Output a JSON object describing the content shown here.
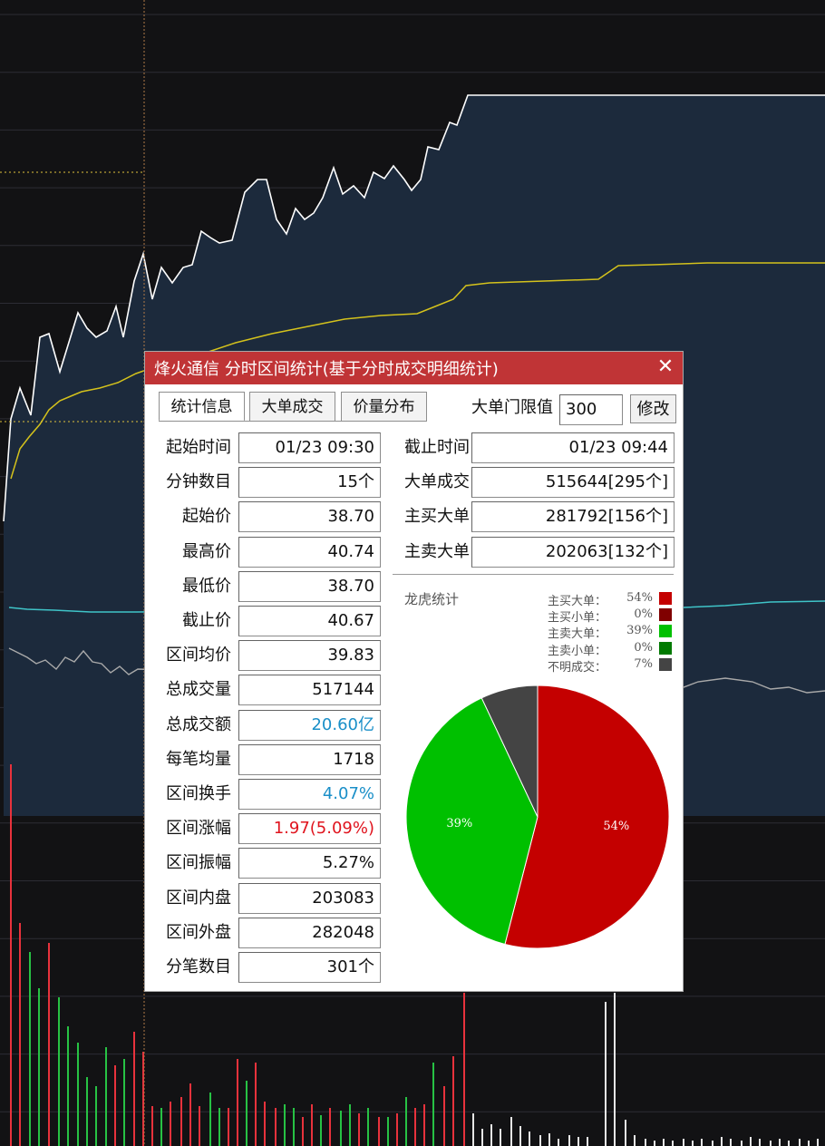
{
  "window": {
    "title": "烽火通信 分时区间统计(基于分时成交明细统计)",
    "close_label": "✕"
  },
  "tabs": [
    {
      "label": "统计信息",
      "active": true
    },
    {
      "label": "大单成交",
      "active": false
    },
    {
      "label": "价量分布",
      "active": false
    }
  ],
  "threshold": {
    "label": "大单门限值",
    "value": "300",
    "modify_label": "修改"
  },
  "left_stats": [
    {
      "label": "起始时间",
      "value": "01/23 09:30",
      "color": "#111111"
    },
    {
      "label": "分钟数目",
      "value": "15个",
      "color": "#111111"
    },
    {
      "label": "起始价",
      "value": "38.70",
      "color": "#111111"
    },
    {
      "label": "最高价",
      "value": "40.74",
      "color": "#111111"
    },
    {
      "label": "最低价",
      "value": "38.70",
      "color": "#111111"
    },
    {
      "label": "截止价",
      "value": "40.67",
      "color": "#111111"
    },
    {
      "label": "区间均价",
      "value": "39.83",
      "color": "#111111"
    },
    {
      "label": "总成交量",
      "value": "517144",
      "color": "#111111"
    },
    {
      "label": "总成交额",
      "value": "20.60亿",
      "color": "#1a8fc8"
    },
    {
      "label": "每笔均量",
      "value": "1718",
      "color": "#111111"
    },
    {
      "label": "区间换手",
      "value": "4.07%",
      "color": "#1a8fc8"
    },
    {
      "label": "区间涨幅",
      "value": "1.97(5.09%)",
      "color": "#e0141e"
    },
    {
      "label": "区间振幅",
      "value": "5.27%",
      "color": "#111111"
    },
    {
      "label": "区间内盘",
      "value": "203083",
      "color": "#111111"
    },
    {
      "label": "区间外盘",
      "value": "282048",
      "color": "#111111"
    },
    {
      "label": "分笔数目",
      "value": "301个",
      "color": "#111111"
    }
  ],
  "right_stats": [
    {
      "label": "截止时间",
      "value": "01/23 09:44"
    },
    {
      "label": "大单成交",
      "value": "515644[295个]"
    },
    {
      "label": "主买大单",
      "value": "281792[156个]"
    },
    {
      "label": "主卖大单",
      "value": "202063[132个]"
    }
  ],
  "pie_title": "龙虎统计",
  "chart_data": {
    "type": "pie",
    "legend_position": "top-right",
    "slices": [
      {
        "name": "主买大单",
        "value": 54,
        "label": "54%",
        "color": "#c40000"
      },
      {
        "name": "主买小单",
        "value": 0,
        "label": "0%",
        "color": "#800000"
      },
      {
        "name": "主卖大单",
        "value": 39,
        "label": "39%",
        "color": "#00c000"
      },
      {
        "name": "主卖小单",
        "value": 0,
        "label": "0%",
        "color": "#007a00"
      },
      {
        "name": "不明成交",
        "value": 7,
        "label": "7%",
        "color": "#444444"
      }
    ]
  },
  "colors": {
    "title_bar": "#c03436",
    "chart_bg": "#121214",
    "price_fill": "#1c2a3c",
    "price_line": "#ffffff",
    "avg_line": "#d4c21c",
    "cyan_line": "#3fc4c8",
    "gray_line": "#a9a9a9",
    "up_bar": "#e8323c",
    "down_bar": "#27c244",
    "neutral_bar": "#e6e6e6"
  }
}
